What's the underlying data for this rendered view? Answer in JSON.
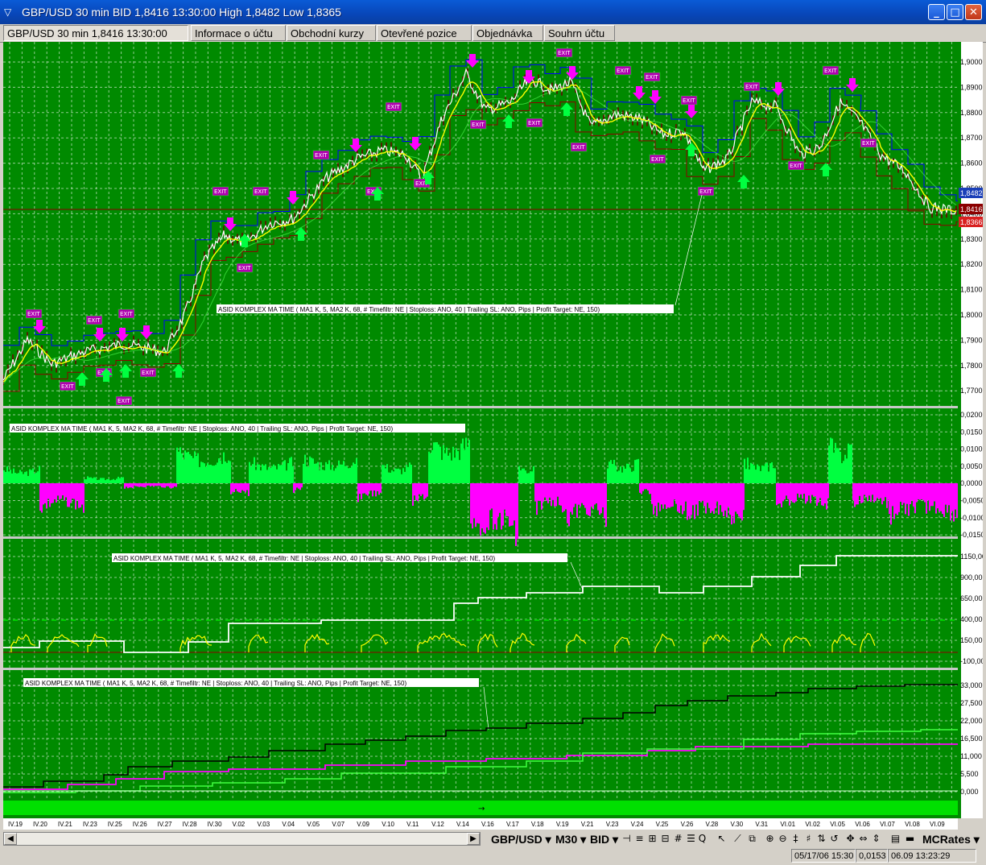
{
  "window": {
    "title": "GBP/USD 30 min BID 1,8416 13:30:00 High 1,8482 Low 1,8365",
    "app_icon": "trading-app-icon"
  },
  "tabs": [
    {
      "label": "GBP/USD 30 min 1,8416 13:30:00",
      "active": true
    },
    {
      "label": "Informace o účtu"
    },
    {
      "label": "Obchodní kurzy"
    },
    {
      "label": "Otevřené pozice"
    },
    {
      "label": "Objednávka"
    },
    {
      "label": "Souhrn účtu"
    }
  ],
  "colors": {
    "background": "#008a00",
    "price_line": "#ffffff",
    "ma1": "#ffff00",
    "ma2": "#008000",
    "buy": "#00ff40",
    "sell": "#ff00ff",
    "channel_upper": "#0000ff",
    "channel_lower": "#8b0000",
    "equity": "#000000"
  },
  "indicator_label": "ASID KOMPLEX MA TIME ( MA1 K, 5,  MA2 K, 68, # Timefiltr: NE | Stoploss: ANO, 40 | Trailing SL: ANO, Pips | Profit Target: NE, 150)",
  "panel1": {
    "axis_labels": [
      "1,9000",
      "1,8900",
      "1,8800",
      "1,8700",
      "1,8600",
      "1,8500",
      "1,8400",
      "1,8300",
      "1,8200",
      "1,8100",
      "1,8000",
      "1,7900",
      "1,7800",
      "1,7700"
    ],
    "price_high": "1,8482",
    "price_current": "1,8416",
    "price_low": "1,8366",
    "marker_exit": "EXIT"
  },
  "panel2": {
    "axis_labels": [
      "0,0200",
      "0,0150",
      "0,0100",
      "0,0050",
      "0,0000",
      "-0,0050",
      "-0,0100",
      "-0,0150"
    ]
  },
  "panel3": {
    "axis_labels": [
      "1150,00",
      "900,00",
      "650,00",
      "400,00",
      "150,00",
      "-100,00"
    ]
  },
  "panel4": {
    "axis_labels": [
      "33,000",
      "27,500",
      "22,000",
      "16,500",
      "11,000",
      "5,500",
      "0,000"
    ]
  },
  "date_axis": [
    "IV.19",
    "IV.20",
    "IV.21",
    "IV.23",
    "IV.25",
    "IV.26",
    "IV.27",
    "IV.28",
    "IV.30",
    "V.02",
    "V.03",
    "V.04",
    "V.05",
    "V.07",
    "V.09",
    "V.10",
    "V.11",
    "V.12",
    "V.14",
    "V.16",
    "V.17",
    "V.18",
    "V.19",
    "V.21",
    "V.23",
    "V.24",
    "V.25",
    "V.26",
    "V.28",
    "V.30",
    "V.31",
    "VI.01",
    "VI.02",
    "VI.05",
    "VI.06",
    "VI.07",
    "VI.08",
    "VI.09"
  ],
  "toolbar": {
    "symbol": "GBP/USD",
    "timeframe": "M30",
    "price_type": "BID",
    "feed": "MCRates"
  },
  "status": {
    "cursor_datetime": "05/17/06 15:30",
    "cursor_value": "0,0153",
    "clock": "06.09 13:23:29"
  }
}
